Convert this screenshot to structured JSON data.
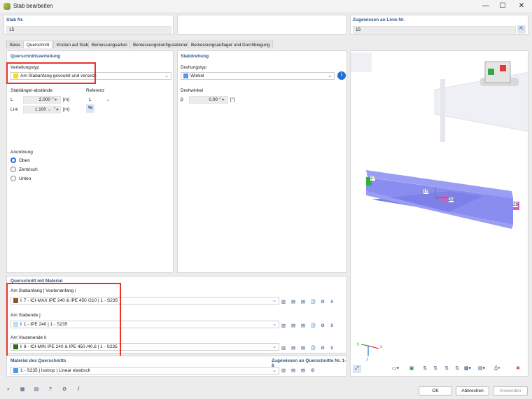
{
  "window": {
    "title": "Stab bearbeiten",
    "minimize": "—",
    "maximize": "☐",
    "close": "✕"
  },
  "header": {
    "stab_nr_label": "Stab Nr.",
    "stab_nr_value": "15",
    "zug_label": "Zugewiesen an Linie Nr.",
    "zug_value": "15"
  },
  "tabs": [
    "Basis",
    "Querschnitt",
    "Knoten auf Stab",
    "Bemessungsarten",
    "Bemessungskonfigurationen",
    "Bemessungsauflager und Durchbiegung"
  ],
  "qv": {
    "title": "Querschnittsverteilung",
    "verteilungstyp_label": "Verteilungstyp",
    "verteilungstyp_value": "Am Stabanfang gevoutet und versetzt",
    "stablaenge_label": "Stablänge/-abstände",
    "referenz_label": "Referenz",
    "L_label": "L",
    "L_value": "2.000",
    "L_unit": "[m]",
    "L_ref": "L",
    "Lik_label": "Li-k",
    "Lik_value": "1.100",
    "Lik_unit": "[m]",
    "pct": "%",
    "anordnung_label": "Anordnung",
    "opt_oben": "Oben",
    "opt_zentrisch": "Zentrisch",
    "opt_unten": "Unten"
  },
  "sd": {
    "title": "Stabdrehung",
    "drehungstyp_label": "Drehungstyp",
    "drehungstyp_value": "Winkel",
    "drehwinkel_label": "Drehwinkel",
    "beta_label": "β",
    "beta_value": "0.00",
    "beta_unit": "[°]"
  },
  "qm": {
    "title": "Querschnitt mit Material",
    "anfang_label": "Am Stabanfang | Voutenanfang i",
    "anfang_value": "7 - ICI-MAX IPE 240 & IPE 450 /210 | 1 - S235",
    "ende_label": "Am Stabende j",
    "ende_value": "1 - IPE 240 | 1 - S235",
    "vouten_label": "Am Voutenende k",
    "vouten_value": "8 - ICI-MIN IPE 240 & IPE 450 /40.6 | 1 - S235"
  },
  "mat": {
    "title": "Material des Querschnitts",
    "zug_label": "Zugewiesen an Querschnitte Nr. 1-8",
    "value": "1 - S235 | Isotrop | Linear elastisch"
  },
  "view3d": {
    "label_15": "15",
    "label_27": "27",
    "label_28": "28",
    "label_26": "26",
    "axis_x": "x",
    "axis_y": "y",
    "axis_z": "z"
  },
  "footer": {
    "ok": "OK",
    "abbrechen": "Abbrechen",
    "anwenden": "Anwenden"
  },
  "colors": {
    "accent": "#1f6fd1",
    "header_blue": "#2f5a8c",
    "highlight": "#e5322d",
    "beam": "#8a8df0"
  }
}
